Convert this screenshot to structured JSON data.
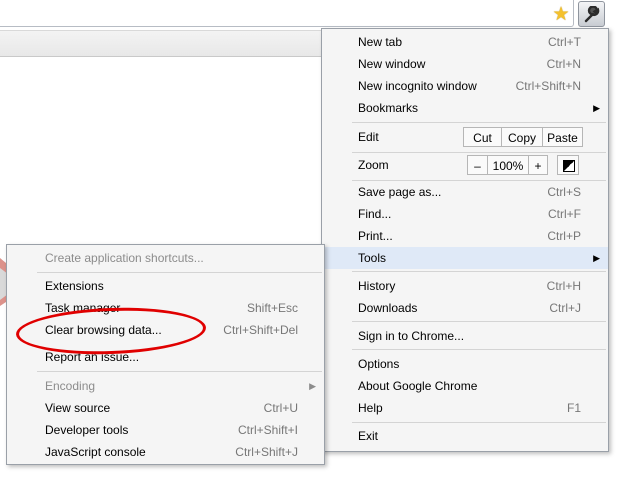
{
  "main_menu": {
    "new_tab": {
      "label": "New tab",
      "shortcut": "Ctrl+T"
    },
    "new_window": {
      "label": "New window",
      "shortcut": "Ctrl+N"
    },
    "new_incognito": {
      "label": "New incognito window",
      "shortcut": "Ctrl+Shift+N"
    },
    "bookmarks": {
      "label": "Bookmarks"
    },
    "edit": {
      "label": "Edit",
      "cut": "Cut",
      "copy": "Copy",
      "paste": "Paste"
    },
    "zoom": {
      "label": "Zoom",
      "minus": "–",
      "value": "100%",
      "plus": "+"
    },
    "save_page": {
      "label": "Save page as...",
      "shortcut": "Ctrl+S"
    },
    "find": {
      "label": "Find...",
      "shortcut": "Ctrl+F"
    },
    "print": {
      "label": "Print...",
      "shortcut": "Ctrl+P"
    },
    "tools": {
      "label": "Tools"
    },
    "history": {
      "label": "History",
      "shortcut": "Ctrl+H"
    },
    "downloads": {
      "label": "Downloads",
      "shortcut": "Ctrl+J"
    },
    "sign_in": {
      "label": "Sign in to Chrome..."
    },
    "options": {
      "label": "Options"
    },
    "about": {
      "label": "About Google Chrome"
    },
    "help": {
      "label": "Help",
      "shortcut": "F1"
    },
    "exit": {
      "label": "Exit"
    }
  },
  "tools_menu": {
    "create_shortcuts": {
      "label": "Create application shortcuts..."
    },
    "extensions": {
      "label": "Extensions"
    },
    "task_manager": {
      "label": "Task manager",
      "shortcut": "Shift+Esc"
    },
    "clear_browsing": {
      "label": "Clear browsing data...",
      "shortcut": "Ctrl+Shift+Del"
    },
    "report_issue": {
      "label": "Report an issue..."
    },
    "encoding": {
      "label": "Encoding"
    },
    "view_source": {
      "label": "View source",
      "shortcut": "Ctrl+U"
    },
    "developer_tools": {
      "label": "Developer tools",
      "shortcut": "Ctrl+Shift+I"
    },
    "javascript_console": {
      "label": "JavaScript console",
      "shortcut": "Ctrl+Shift+J"
    }
  },
  "icons": {
    "star": "bookmark-star-icon",
    "wrench": "wrench-icon",
    "arrow": "submenu-arrow-icon"
  },
  "colors": {
    "highlight": "#dfe9f7",
    "annotation": "#e00000",
    "star": "#f4c12d"
  }
}
